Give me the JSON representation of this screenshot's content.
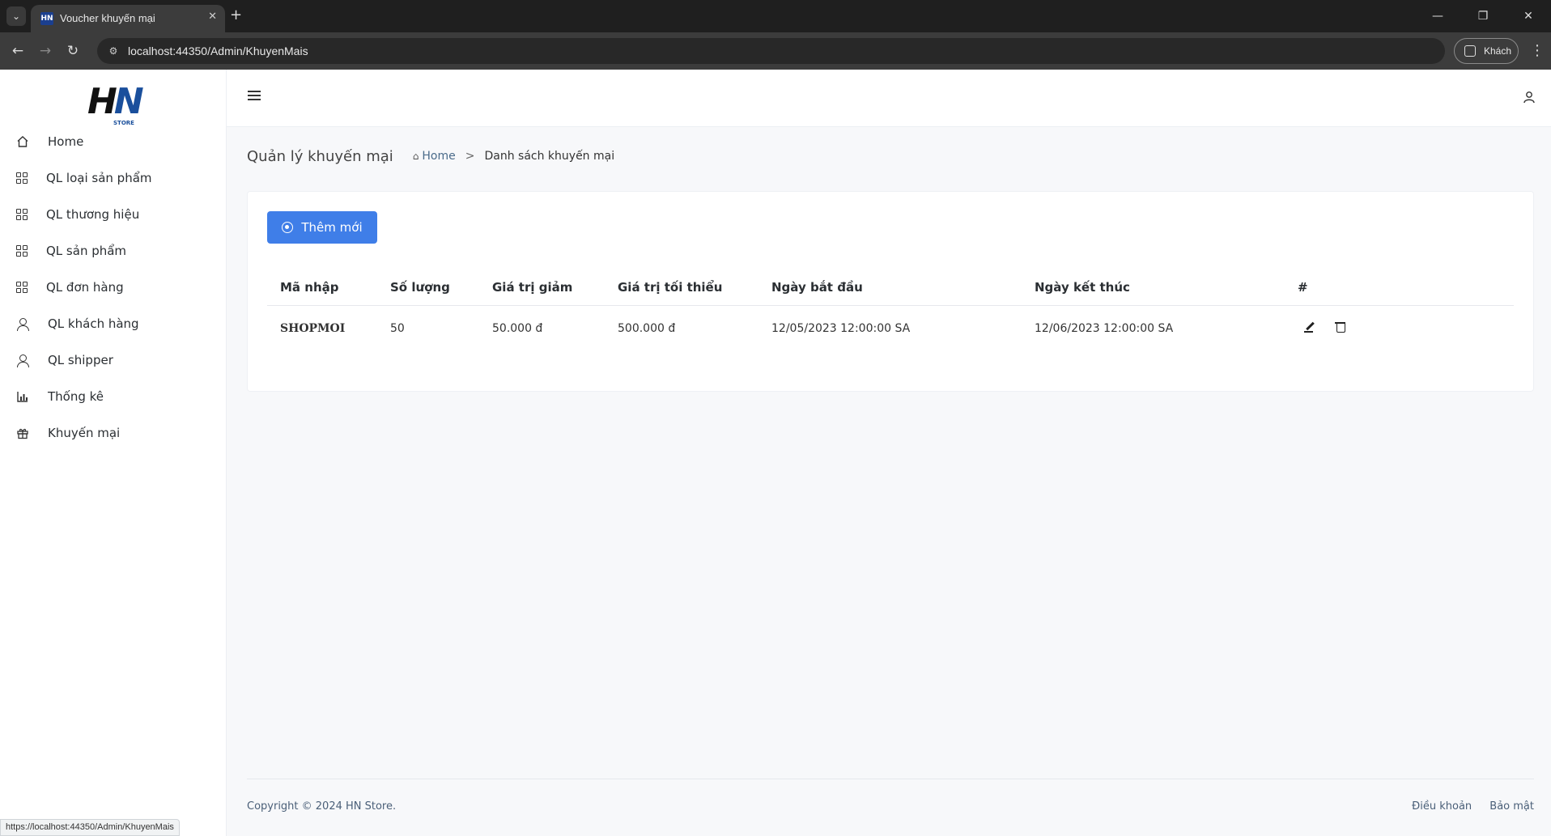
{
  "browser": {
    "tab_title": "Voucher khuyến mại",
    "favicon_text": "HN",
    "url": "localhost:44350/Admin/KhuyenMais",
    "profile_label": "Khách",
    "status_url": "https://localhost:44350/Admin/KhuyenMais"
  },
  "logo": {
    "text_h": "H",
    "text_n": "N",
    "store": "STORE"
  },
  "sidebar": {
    "items": [
      {
        "label": "Home",
        "icon": "home-icon"
      },
      {
        "label": "QL loại sản phẩm",
        "icon": "grid-icon"
      },
      {
        "label": "QL thương hiệu",
        "icon": "grid-icon"
      },
      {
        "label": "QL sản phẩm",
        "icon": "grid-icon"
      },
      {
        "label": "QL đơn hàng",
        "icon": "grid-icon"
      },
      {
        "label": "QL khách hàng",
        "icon": "user-icon"
      },
      {
        "label": "QL shipper",
        "icon": "user-icon"
      },
      {
        "label": "Thống kê",
        "icon": "chart-icon"
      },
      {
        "label": "Khuyến mại",
        "icon": "gift-icon"
      }
    ]
  },
  "page": {
    "title": "Quản lý khuyến mại",
    "breadcrumb": {
      "home": "Home",
      "separator": ">",
      "current": "Danh sách khuyến mại"
    },
    "add_button": "Thêm mới"
  },
  "table": {
    "headers": [
      "Mã nhập",
      "Số lượng",
      "Giá trị giảm",
      "Giá trị tối thiểu",
      "Ngày bắt đầu",
      "Ngày kết thúc",
      "#"
    ],
    "rows": [
      {
        "code": "SHOPMOI",
        "quantity": "50",
        "discount": "50.000 đ",
        "minimum": "500.000 đ",
        "start": "12/05/2023 12:00:00 SA",
        "end": "12/06/2023 12:00:00 SA"
      }
    ]
  },
  "footer": {
    "copyright": "Copyright © 2024 HN Store.",
    "terms": "Điều khoản",
    "privacy": "Bảo mật"
  },
  "colors": {
    "primary": "#3f7ee8",
    "chrome_dark": "#1f1f1f",
    "chrome_bar": "#3c3c3c",
    "brand": "#1a4f9c"
  }
}
